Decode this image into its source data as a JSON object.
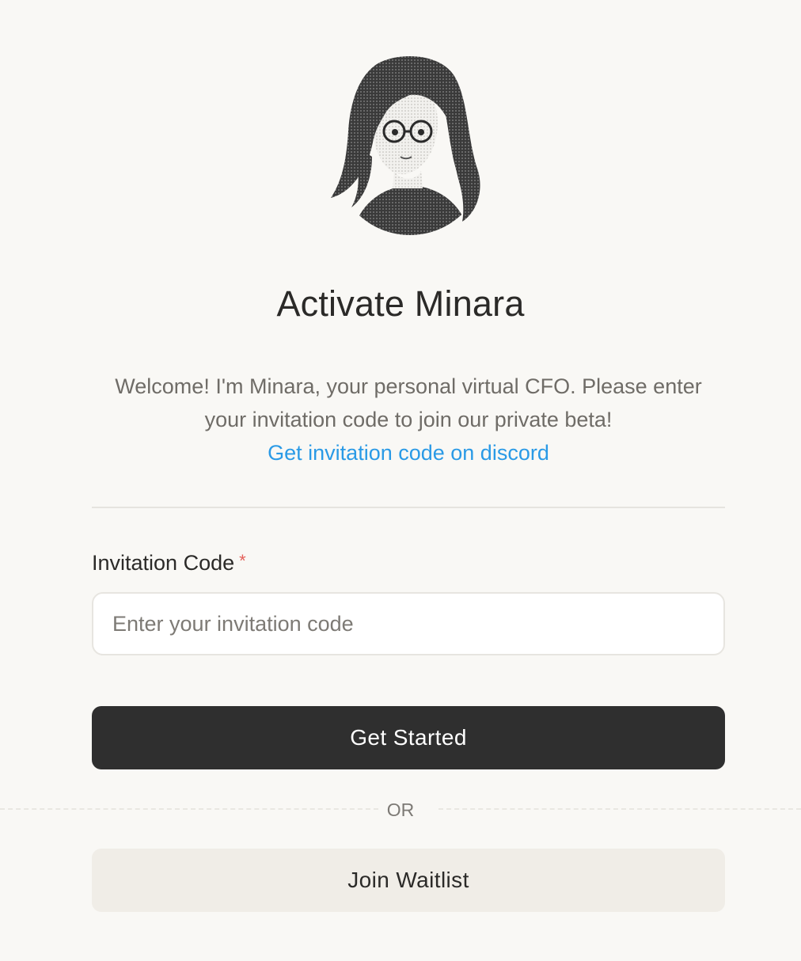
{
  "header": {
    "title": "Activate Minara"
  },
  "intro": {
    "text": "Welcome! I'm Minara, your personal virtual CFO. Please enter your invitation code to join our private beta!",
    "discord_link": "Get invitation code on discord"
  },
  "form": {
    "label": "Invitation Code",
    "required_marker": "*",
    "placeholder": "Enter your invitation code",
    "value": ""
  },
  "actions": {
    "primary_label": "Get Started",
    "separator": "OR",
    "secondary_label": "Join Waitlist"
  },
  "colors": {
    "background": "#f9f8f5",
    "primary_button": "#2f2f2f",
    "secondary_button": "#f0ede7",
    "link": "#2a9ae6",
    "required": "#e4605a"
  },
  "icons": {
    "avatar": "minara-avatar-illustration"
  }
}
